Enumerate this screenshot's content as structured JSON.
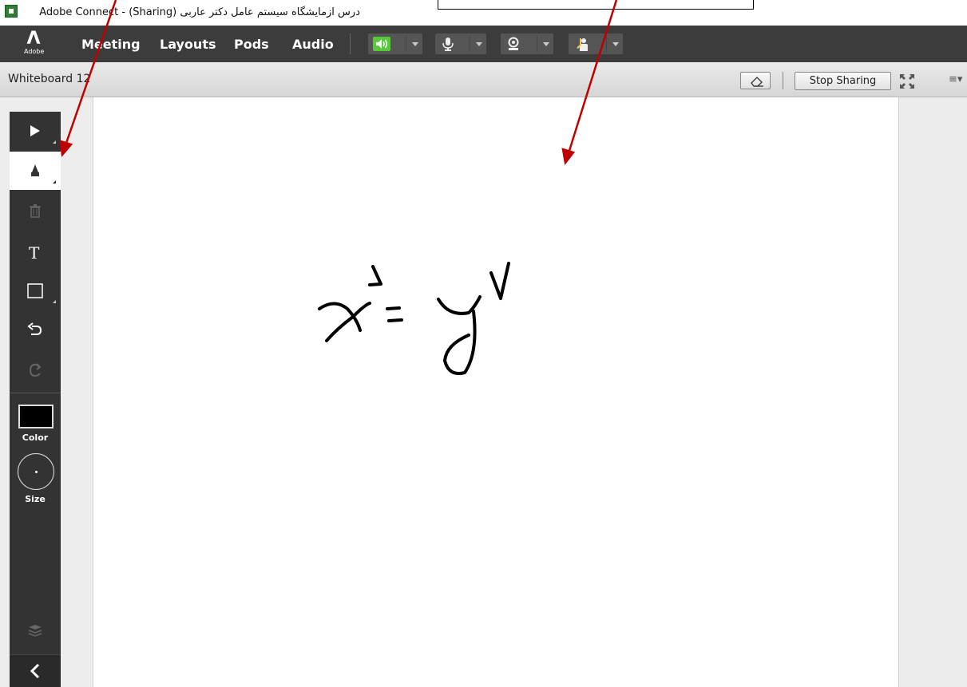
{
  "window": {
    "title": "درس ازمایشگاه سیستم عامل دکتر عاربی (Sharing) - Adobe Connect"
  },
  "menubar": {
    "logo_text": "Adobe",
    "items": [
      {
        "label": "Meeting"
      },
      {
        "label": "Layouts"
      },
      {
        "label": "Pods"
      },
      {
        "label": "Audio"
      }
    ],
    "controls": [
      {
        "icon": "speaker-icon",
        "active_color": "#59c93b"
      },
      {
        "icon": "microphone-icon"
      },
      {
        "icon": "webcam-icon"
      },
      {
        "icon": "raise-hand-icon"
      }
    ]
  },
  "pod": {
    "title": "Whiteboard 12",
    "stop_sharing_label": "Stop Sharing"
  },
  "toolbar": {
    "tools": [
      {
        "name": "selection-tool",
        "icon": "arrow-pointer-icon"
      },
      {
        "name": "pencil-tool",
        "icon": "pencil-icon",
        "active": true
      },
      {
        "name": "delete-tool",
        "icon": "trash-icon",
        "disabled": true
      },
      {
        "name": "text-tool",
        "icon": "text-T-icon"
      },
      {
        "name": "shape-tool",
        "icon": "rectangle-icon"
      },
      {
        "name": "undo-tool",
        "icon": "undo-icon"
      },
      {
        "name": "redo-tool",
        "icon": "redo-icon",
        "disabled": true
      }
    ],
    "color_label": "Color",
    "size_label": "Size",
    "current_color": "#000000"
  },
  "colors": {
    "arrow": "#c00000",
    "dark_bar": "#3c3c3c",
    "palette": "#333333"
  }
}
